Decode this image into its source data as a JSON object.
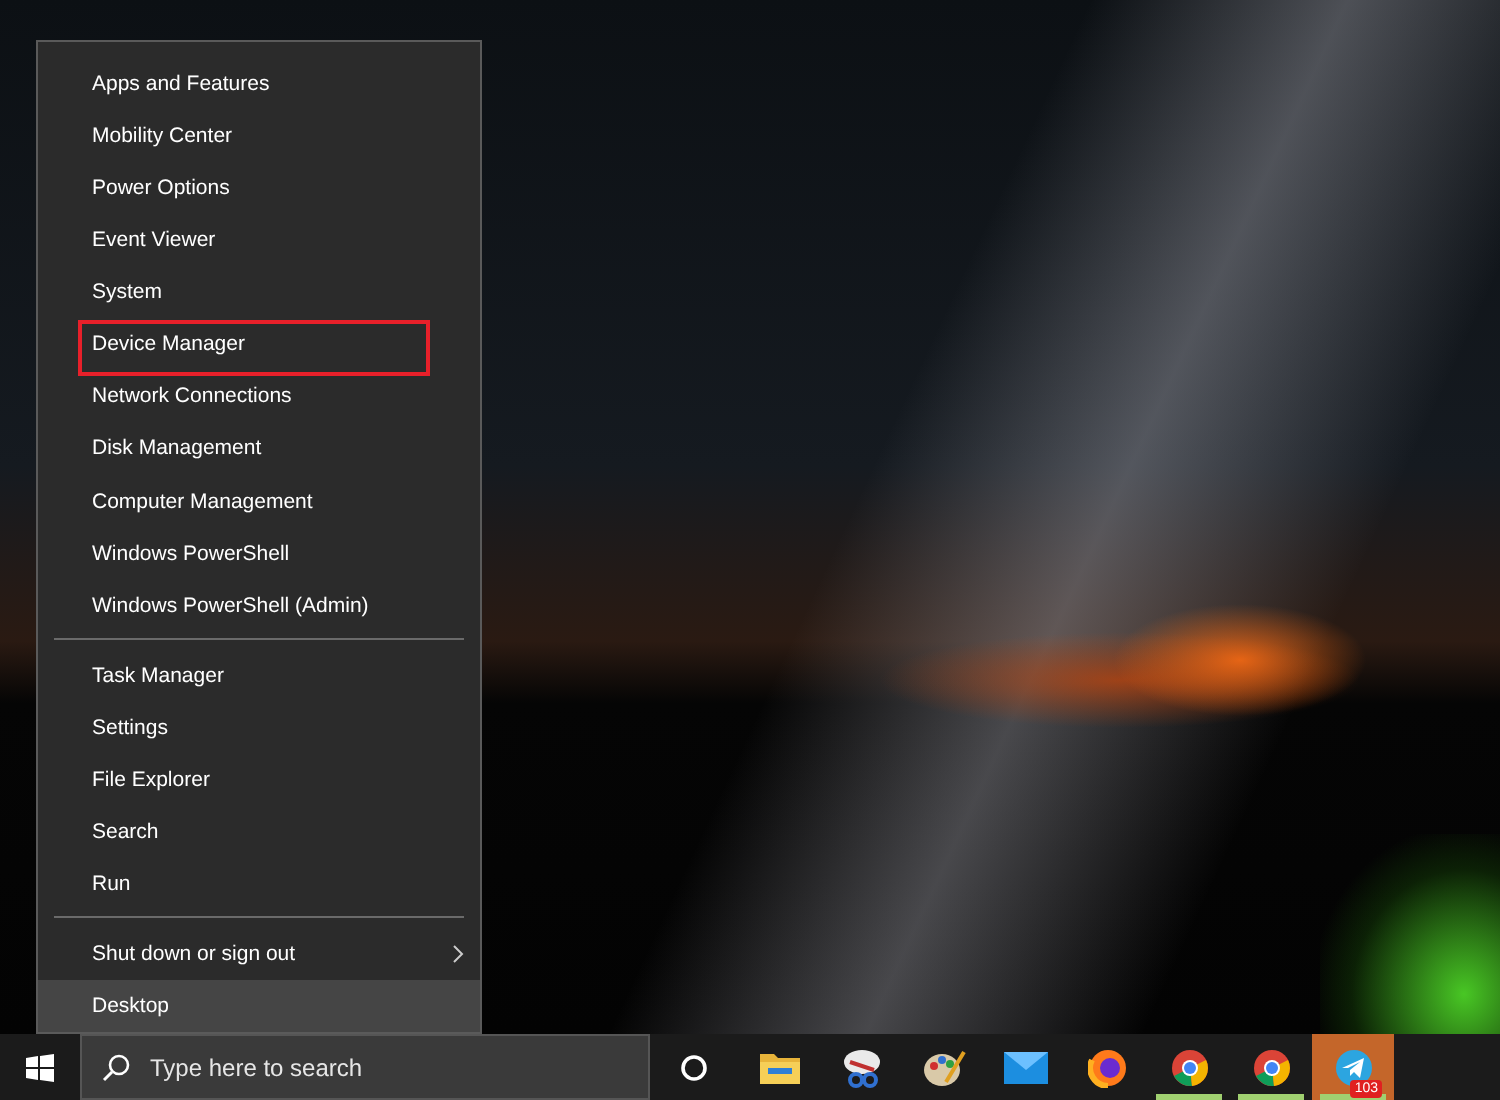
{
  "menu": {
    "groups": [
      {
        "items": [
          {
            "label": "Apps and Features",
            "selected": false,
            "outlined": false,
            "submenu": false
          },
          {
            "label": "Mobility Center",
            "selected": false,
            "outlined": false,
            "submenu": false
          },
          {
            "label": "Power Options",
            "selected": false,
            "outlined": false,
            "submenu": false
          },
          {
            "label": "Event Viewer",
            "selected": false,
            "outlined": false,
            "submenu": false
          },
          {
            "label": "System",
            "selected": false,
            "outlined": false,
            "submenu": false
          },
          {
            "label": "Device Manager",
            "selected": false,
            "outlined": true,
            "submenu": false
          },
          {
            "label": "Network Connections",
            "selected": false,
            "outlined": false,
            "submenu": false
          },
          {
            "label": "Disk Management",
            "selected": false,
            "outlined": false,
            "submenu": false
          },
          {
            "label": "Computer Management",
            "selected": false,
            "outlined": false,
            "submenu": false
          },
          {
            "label": "Windows PowerShell",
            "selected": false,
            "outlined": false,
            "submenu": false
          },
          {
            "label": "Windows PowerShell (Admin)",
            "selected": false,
            "outlined": false,
            "submenu": false
          }
        ]
      },
      {
        "items": [
          {
            "label": "Task Manager",
            "selected": false,
            "outlined": false,
            "submenu": false
          },
          {
            "label": "Settings",
            "selected": false,
            "outlined": false,
            "submenu": false
          },
          {
            "label": "File Explorer",
            "selected": false,
            "outlined": false,
            "submenu": false
          },
          {
            "label": "Search",
            "selected": false,
            "outlined": false,
            "submenu": false
          },
          {
            "label": "Run",
            "selected": false,
            "outlined": false,
            "submenu": false
          }
        ]
      },
      {
        "items": [
          {
            "label": "Shut down or sign out",
            "selected": false,
            "outlined": false,
            "submenu": true
          },
          {
            "label": "Desktop",
            "selected": true,
            "outlined": false,
            "submenu": false
          }
        ]
      }
    ]
  },
  "taskbar": {
    "search": {
      "placeholder": "Type here to search"
    },
    "apps": [
      {
        "kind": "folder",
        "running": false,
        "active": false
      },
      {
        "kind": "snip",
        "running": false,
        "active": false
      },
      {
        "kind": "paint",
        "running": false,
        "active": false
      },
      {
        "kind": "mail",
        "running": false,
        "active": false
      },
      {
        "kind": "firefox",
        "running": false,
        "active": false
      },
      {
        "kind": "chrome",
        "running": true,
        "active": false
      },
      {
        "kind": "chrome",
        "running": true,
        "active": false
      },
      {
        "kind": "telegram",
        "running": true,
        "active": true,
        "badge": "103"
      }
    ]
  }
}
